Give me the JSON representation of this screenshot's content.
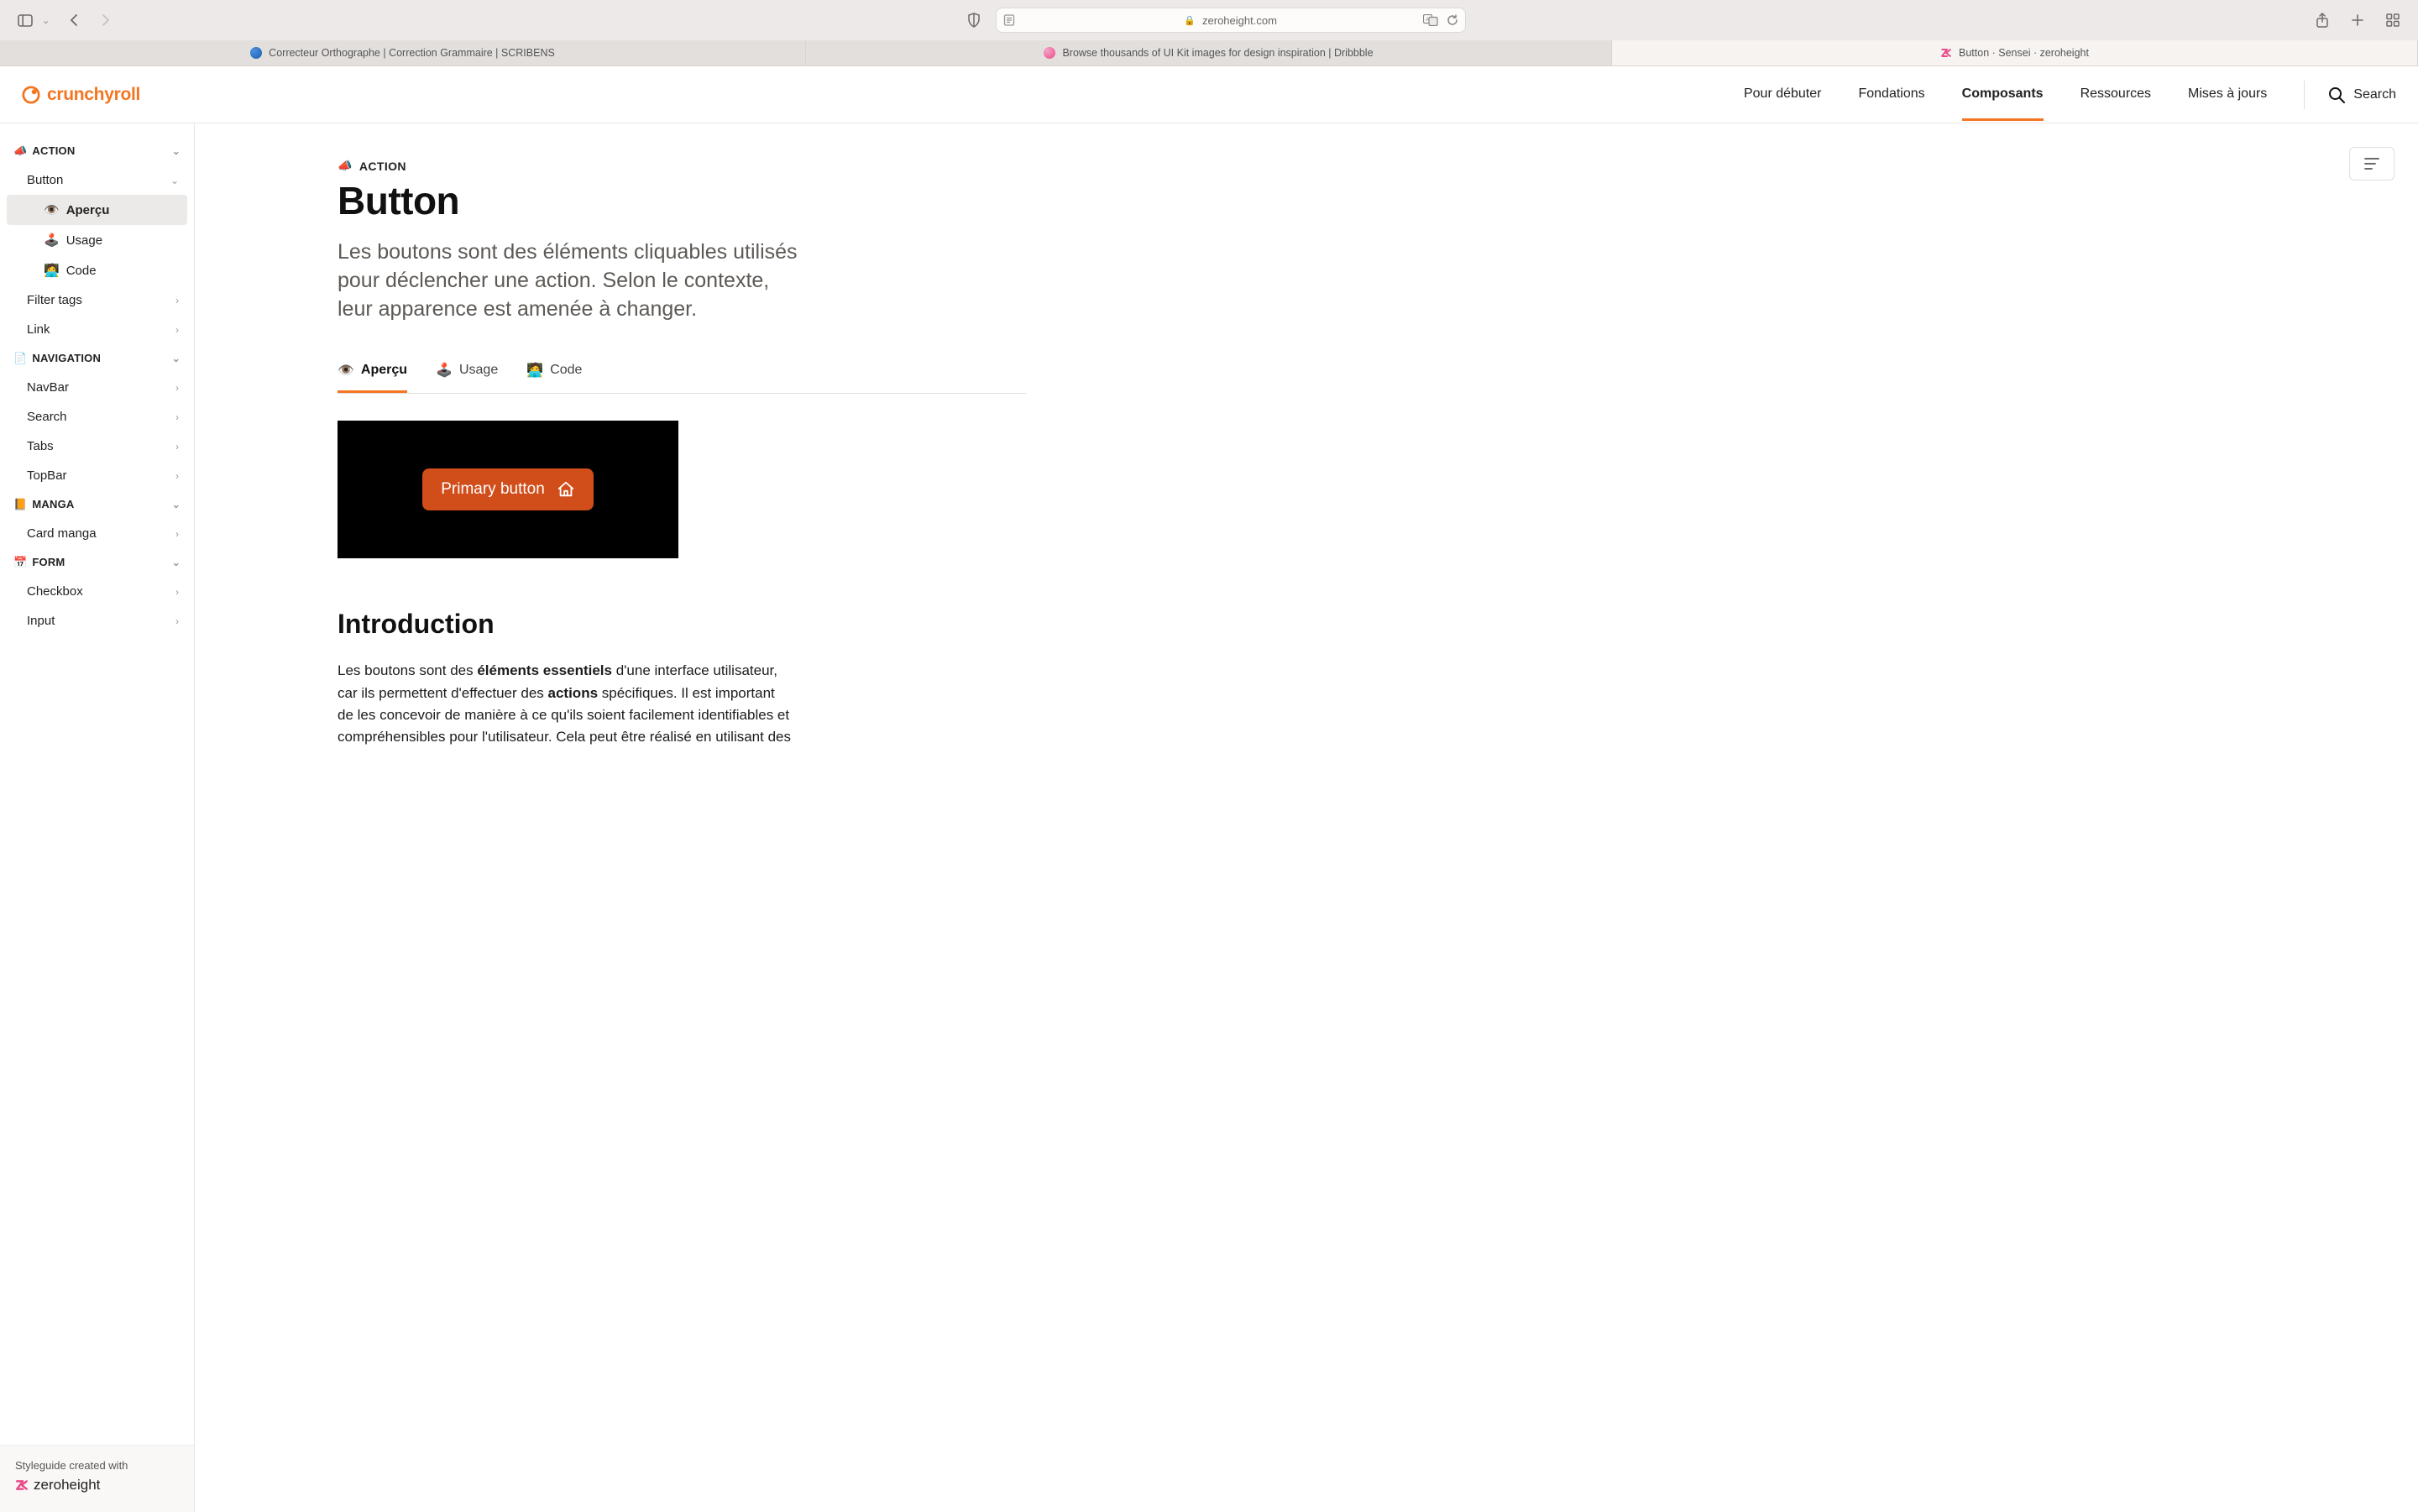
{
  "browser": {
    "url": "zeroheight.com",
    "tabs": [
      {
        "label": "Correcteur Orthographe | Correction Grammaire | SCRIBENS"
      },
      {
        "label": "Browse thousands of UI Kit images for design inspiration | Dribbble"
      },
      {
        "label": "Button · Sensei  · zeroheight"
      }
    ]
  },
  "header": {
    "brand": "crunchyroll",
    "nav": {
      "start": "Pour débuter",
      "foundations": "Fondations",
      "components": "Composants",
      "resources": "Ressources",
      "updates": "Mises à jours"
    },
    "search": "Search"
  },
  "sidebar": {
    "groups": {
      "action": "ACTION",
      "navigation": "NAVIGATION",
      "manga": "MANGA",
      "form": "FORM"
    },
    "items": {
      "button": "Button",
      "filter_tags": "Filter tags",
      "link": "Link",
      "navbar": "NavBar",
      "search": "Search",
      "tabs": "Tabs",
      "topbar": "TopBar",
      "card_manga": "Card manga",
      "checkbox": "Checkbox",
      "input": "Input"
    },
    "subs": {
      "apercu": "Aperçu",
      "usage": "Usage",
      "code": "Code"
    },
    "footer": {
      "line1": "Styleguide created with",
      "brand": "zeroheight"
    }
  },
  "content": {
    "breadcrumb": "ACTION",
    "title": "Button",
    "lead": "Les boutons sont des éléments cliquables utilisés pour déclencher une action. Selon le contexte, leur apparence est amenée à changer.",
    "tabs": {
      "apercu": "Aperçu",
      "usage": "Usage",
      "code": "Code"
    },
    "demo_button": "Primary button",
    "intro_heading": "Introduction",
    "intro_p_pre": "Les boutons sont des ",
    "intro_p_b1": "éléments essentiels",
    "intro_p_mid1": " d'une interface utilisateur, car ils permettent d'effectuer des ",
    "intro_p_b2": "actions",
    "intro_p_post": " spécifiques. Il est important de les concevoir de manière à ce qu'ils soient facilement identifiables et compréhensibles pour l'utilisateur. Cela peut être réalisé en utilisant des"
  },
  "emoji": {
    "megaphone": "📣",
    "eye": "👁️",
    "joystick": "🕹️",
    "technologist": "🧑‍💻",
    "page": "📄",
    "book": "📙",
    "calendar": "📅"
  }
}
